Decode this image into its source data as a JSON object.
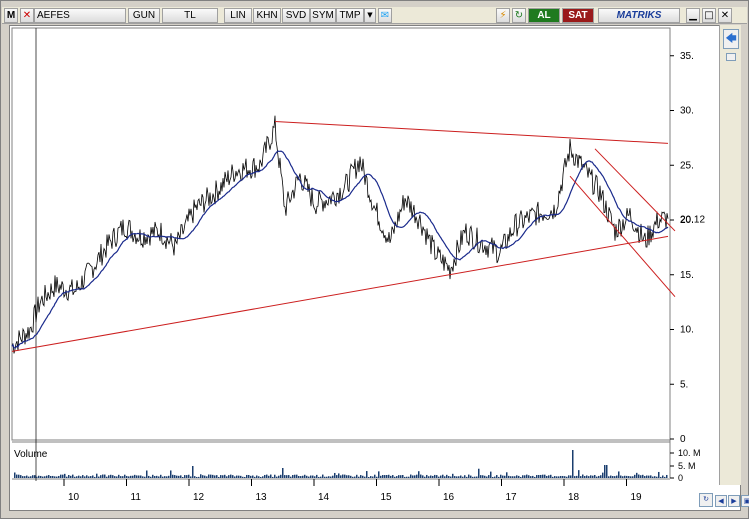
{
  "toolbar": {
    "m_label": "M",
    "symbol": "AEFES",
    "items": [
      "GUN",
      "TL",
      "LIN",
      "KHN",
      "SVD",
      "SYM",
      "TMP"
    ],
    "buy_label": "AL",
    "sell_label": "SAT",
    "brand": "MATRIKS",
    "window_controls": [
      "minimize-icon",
      "maximize-icon",
      "close-icon"
    ],
    "colors": {
      "buy": "#1f7a1f",
      "sell": "#9a1a1a",
      "brand": "#1a3d9a"
    }
  },
  "chart_data": {
    "type": "line",
    "title": "",
    "x_ticks": [
      "10",
      "11",
      "12",
      "13",
      "14",
      "15",
      "16",
      "17",
      "18",
      "19"
    ],
    "y_ticks": [
      "35.",
      "30.",
      "25.",
      "20.",
      "15.",
      "10.",
      "5.",
      "0"
    ],
    "last_price_label": "20.12",
    "ylim": [
      0,
      37
    ],
    "grid": false,
    "volume_label": "Volume",
    "volume_ticks": [
      "10. M",
      "5. M",
      "0"
    ],
    "price_series_color": "#000000",
    "ma_series_color": "#1a2a8c",
    "trendline_color": "#cc1f1f"
  },
  "side": {
    "icons": [
      "arrow-left-icon",
      "small-square-icon"
    ]
  },
  "bottom": {
    "icons": [
      "refresh-icon",
      "scroll-left-icon",
      "scroll-right-icon",
      "fit-icon"
    ]
  }
}
